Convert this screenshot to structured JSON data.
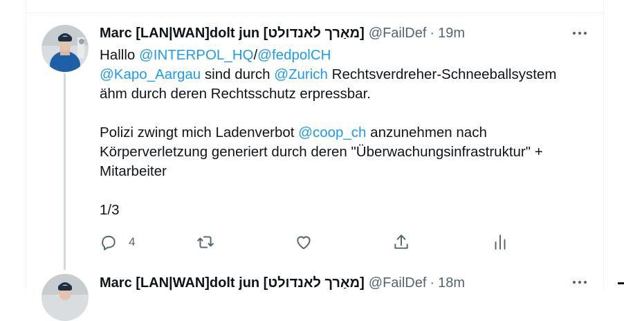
{
  "tweets": [
    {
      "name": "Marc [LAN|WAN]dolt jun [מאַרך לאנדולט]",
      "handle": "@FailDef",
      "separator": "·",
      "time": "19m",
      "lines": [
        {
          "t1": "Halllo ",
          "m1": "@INTERPOL_HQ",
          "t2": "/",
          "m2": "@fedpolCH"
        },
        {
          "m1": "@Kapo_Aargau",
          "t1": " sind durch ",
          "m2": "@Zurich",
          "t2": " Rechtsverdreher-Schneeballsystem"
        },
        {
          "t1": "ähm durch deren Rechtsschutz erpressbar."
        },
        {
          "t1": "Polizi zwingt mich Ladenverbot ",
          "m1": "@coop_ch",
          "t2": " anzunehmen nach"
        },
        {
          "t1": "Körperverletzung generiert durch deren \"Überwachungsinfrastruktur\" +"
        },
        {
          "t1": "Mitarbeiter"
        },
        {
          "t1": "1/3"
        }
      ],
      "reply_count": "4"
    },
    {
      "name": "Marc [LAN|WAN]dolt jun [מאַרך לאנדולט]",
      "handle": "@FailDef",
      "separator": "·",
      "time": "18m"
    }
  ],
  "icons": {
    "reply": "reply-icon",
    "retweet": "retweet-icon",
    "like": "like-icon",
    "share": "share-icon",
    "analytics": "analytics-icon",
    "more": "more-icon"
  },
  "colors": {
    "mention": "#1d9bf0",
    "secondary_text": "#536471",
    "thread_line": "#cfd9de",
    "divider": "#eff3f4"
  }
}
